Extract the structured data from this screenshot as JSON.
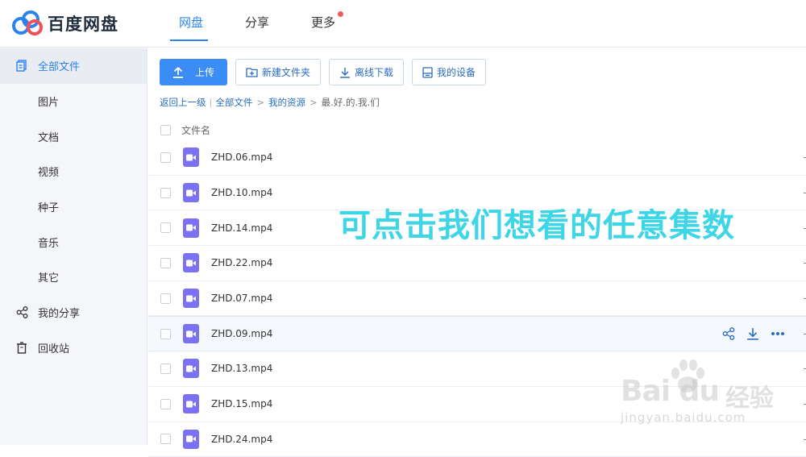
{
  "app": {
    "logo_text": "百度网盘",
    "nav": [
      {
        "label": "网盘",
        "active": true
      },
      {
        "label": "分享",
        "active": false
      },
      {
        "label": "更多",
        "active": false,
        "dot": true
      }
    ]
  },
  "sidebar": {
    "items": [
      {
        "label": "全部文件",
        "icon": "files-icon",
        "active": true
      },
      {
        "label": "图片",
        "sub": true
      },
      {
        "label": "文档",
        "sub": true
      },
      {
        "label": "视频",
        "sub": true
      },
      {
        "label": "种子",
        "sub": true
      },
      {
        "label": "音乐",
        "sub": true
      },
      {
        "label": "其它",
        "sub": true
      },
      {
        "label": "我的分享",
        "icon": "share-icon"
      },
      {
        "label": "回收站",
        "icon": "trash-icon"
      }
    ]
  },
  "toolbar": {
    "upload": "上传",
    "new_folder": "新建文件夹",
    "offline_download": "离线下载",
    "my_devices": "我的设备"
  },
  "breadcrumb": {
    "back": "返回上一级",
    "all_files": "全部文件",
    "my_resources": "我的资源",
    "current": "最.好.的.我.们"
  },
  "list": {
    "header_name": "文件名",
    "files": [
      {
        "name": "ZHD.06.mp4"
      },
      {
        "name": "ZHD.10.mp4"
      },
      {
        "name": "ZHD.14.mp4"
      },
      {
        "name": "ZHD.22.mp4"
      },
      {
        "name": "ZHD.07.mp4"
      },
      {
        "name": "ZHD.09.mp4",
        "hover": true
      },
      {
        "name": "ZHD.13.mp4"
      },
      {
        "name": "ZHD.15.mp4"
      },
      {
        "name": "ZHD.24.mp4"
      }
    ]
  },
  "overlay_caption": "可点击我们想看的任意集数",
  "watermark": {
    "logo": "Bai du",
    "cn": "经验",
    "url": "jingyan.baidu.com"
  },
  "colors": {
    "accent": "#2a83f0",
    "primary_button": "#3b8cf5",
    "video_icon": "#7b72f3",
    "caption": "#3ed6e6",
    "notify_dot": "#f25b5b"
  }
}
